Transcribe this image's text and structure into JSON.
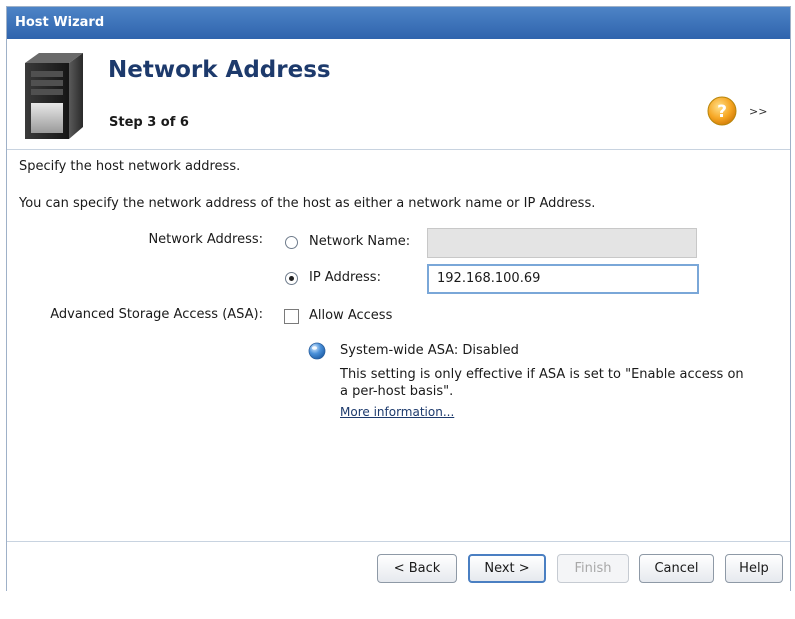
{
  "window": {
    "title": "Host Wizard"
  },
  "header": {
    "title": "Network Address",
    "step": "Step 3 of 6",
    "expand_label": ">>"
  },
  "body": {
    "intro": "Specify the host network address.",
    "description": "You can specify the network address of the host as either a network name or IP Address.",
    "network_address_label": "Network Address:",
    "network_name_option": "Network Name:",
    "network_name_value": "",
    "ip_address_option": "IP Address:",
    "ip_address_value": "192.168.100.69",
    "selected_option": "ip_address",
    "asa_label": "Advanced Storage Access (ASA):",
    "allow_access_label": "Allow Access",
    "allow_access_checked": false,
    "asa_status": "System-wide ASA: Disabled",
    "asa_note_line1": "This setting is only effective if ASA is set to \"Enable access on",
    "asa_note_line2": "a per-host basis\".",
    "more_info_link": "More information..."
  },
  "footer": {
    "back": "< Back",
    "next": "Next >",
    "finish": "Finish",
    "cancel": "Cancel",
    "help": "Help"
  },
  "colors": {
    "titlebar": "#2f64ad",
    "header_title": "#1d3a6c",
    "input_focus_border": "#7aa7d8",
    "disabled_input": "#e4e4e4"
  },
  "icons": [
    "server-icon",
    "help-icon",
    "info-icon"
  ]
}
